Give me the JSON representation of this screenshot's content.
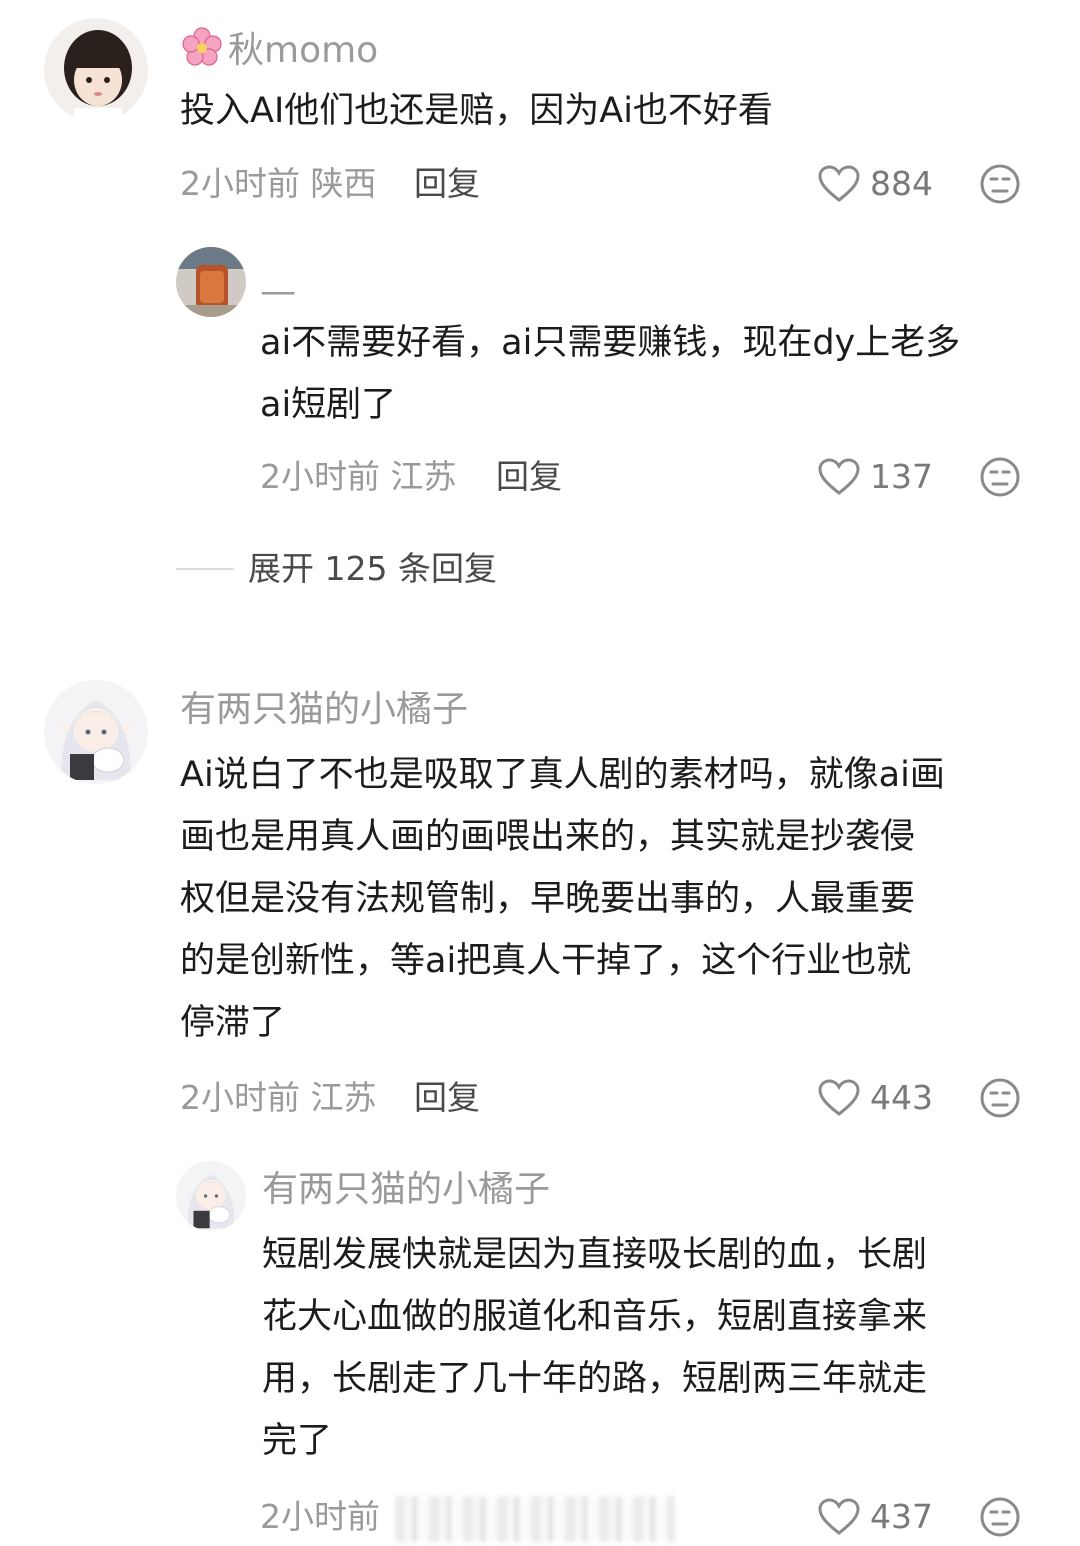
{
  "comments": [
    {
      "username": "秋momo",
      "username_prefix_icon": "flower-icon",
      "text": "投入AI他们也还是赔，因为Ai也不好看",
      "time": "2小时前",
      "location": "陕西",
      "reply_label": "回复",
      "likes": "884",
      "replies": [
        {
          "username": "—",
          "text_line1": "ai不需要好看，ai只需要赚钱，现在dy上老多",
          "text_line2": "ai短剧了",
          "time": "2小时前",
          "location": "江苏",
          "reply_label": "回复",
          "likes": "137"
        }
      ],
      "expand_label": "展开 125 条回复"
    },
    {
      "username": "有两只猫的小橘子",
      "text_lines": [
        "Ai说白了不也是吸取了真人剧的素材吗，就像ai画",
        "画也是用真人画的画喂出来的，其实就是抄袭侵",
        "权但是没有法规管制，早晚要出事的，人最重要",
        "的是创新性，等ai把真人干掉了，这个行业也就",
        "停滞了"
      ],
      "time": "2小时前",
      "location": "江苏",
      "reply_label": "回复",
      "likes": "443",
      "replies": [
        {
          "username": "有两只猫的小橘子",
          "text_lines": [
            "短剧发展快就是因为直接吸长剧的血，长剧",
            "花大心血做的服道化和音乐，短剧直接拿来",
            "用，长剧走了几十年的路，短剧两三年就走",
            "完了"
          ],
          "time": "2小时前",
          "likes": "437"
        }
      ]
    }
  ],
  "colors": {
    "text": "#1c1c1c",
    "meta": "#9a9a9a",
    "accent_flower": "#f06b9a"
  }
}
